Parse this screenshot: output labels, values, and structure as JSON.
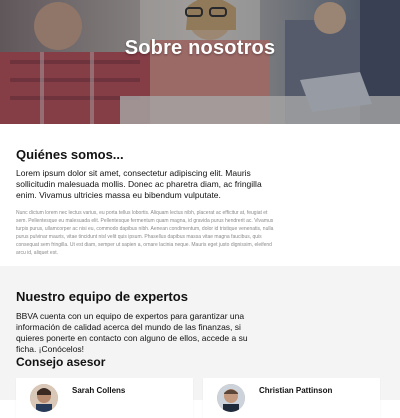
{
  "hero": {
    "title": "Sobre nosotros",
    "image_icon": "team-office-photo"
  },
  "about": {
    "heading": "Quiénes somos...",
    "lead": "Lorem ipsum dolor sit amet, consectetur adipiscing elit. Mauris sollicitudin malesuada mollis. Donec ac pharetra diam, ac fringilla enim. Vivamus ultricies massa eu bibendum vulputate.",
    "body": "Nunc dictum lorem nec lectus varius, eu porta tellus lobortis. Aliquam lectus nibh, placerat ac efficitur at, feugiat et sem. Pellentesque eu malesuada elit. Pellentesque fermentum quam magna, id gravida purus hendrerit ac. Vivamus turpis purus, ullamcorper ac nisi eu, commodo dapibus nibh. Aenean condimentum, dolor id tristique venenatis, nulla purus pulvinar mauris, vitae tincidunt nisl velit quis ipsum. Phasellus dapibus massa vitae magna faucibus, quis consequat sem fringilla. Ut est diam, semper ut sapien a, ornare lacinia neque. Mauris eget justo dignissim, eleifend arcu id, aliquet est."
  },
  "team": {
    "heading": "Nuestro equipo de expertos",
    "lead": "BBVA cuenta con un equipo de expertos para garantizar una información de calidad acerca del mundo de las finanzas, si quieres ponerte en contacto con alguno de ellos, accede a su ficha. ¡Conócelos!",
    "subheading": "Consejo asesor",
    "members": [
      {
        "name": "Sarah Collens",
        "avatar_icon": "person-avatar"
      },
      {
        "name": "Christian Pattinson",
        "avatar_icon": "person-avatar"
      }
    ]
  },
  "colors": {
    "hero_overlay": "#2f3340",
    "section_bg": "#f4f4f4",
    "text": "#121212",
    "muted": "#8a8a8a"
  }
}
